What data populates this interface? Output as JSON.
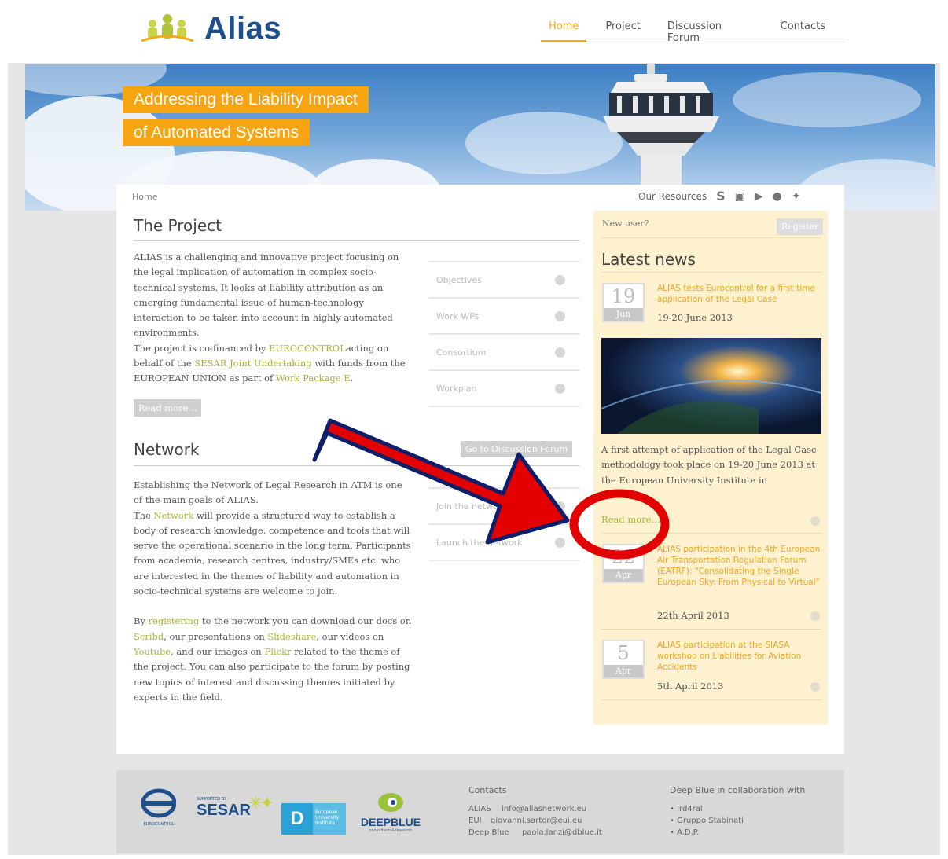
{
  "header": {
    "logo_text": "Alias",
    "nav": [
      "Home",
      "Project",
      "Discussion Forum",
      "Contacts"
    ]
  },
  "hero": {
    "tagline_line1": "Addressing the Liability Impact",
    "tagline_line2": "of Automated Systems"
  },
  "breadcrumb": "Home",
  "resources_label": "Our Resources",
  "social_icons": [
    "scribd-icon",
    "slideshare-icon",
    "youtube-icon",
    "flickr-icon",
    "twitter-icon"
  ],
  "project": {
    "title": "The Project",
    "p1": "ALIAS is a challenging and innovative project focusing on the legal implication of automation in complex socio-technical systems. It looks at liability attribution as an emerging fundamental issue of human-technology interaction to be taken into account in highly automated environments.",
    "p2_a": "The project is co-financed by ",
    "p2_link1": "EUROCONTROL",
    "p2_b": "acting on behalf of the ",
    "p2_link2": "SESAR Joint Undertaking",
    "p2_c": " with funds from the EUROPEAN UNION as part of ",
    "p2_link3": "Work Package E",
    "p2_d": ".",
    "read_more": "Read more..."
  },
  "project_menu": [
    "Objectives",
    "Work WPs",
    "Consortium",
    "Workplan"
  ],
  "network": {
    "title": "Network",
    "forum_button": "Go to Discussion Forum",
    "p1": "Establishing the Network of Legal Research in ATM is one of the main goals of ALIAS.",
    "p2_a": "The ",
    "p2_link": "Network",
    "p2_b": " will provide a structured way to establish a body of research knowledge, competence and tools that will serve the operational scenario in the long term. Participants from academia, research centres, industry/SMEs etc. who are interested in the themes of liability and automation in socio-technical systems are welcome to join.",
    "p3_a": "By ",
    "p3_l1": "registering",
    "p3_b": " to the network you can download our docs on ",
    "p3_l2": "Scribd",
    "p3_c": ", our presentations on ",
    "p3_l3": "Slideshare",
    "p3_d": ", our videos on ",
    "p3_l4": "Youtube",
    "p3_e": ", and our images on ",
    "p3_l5": "Flickr",
    "p3_f": " related to the theme of the project. You can also participate to the forum by posting new topics of interest and discussing themes initiated by experts in the field."
  },
  "network_menu": [
    "Join the network",
    "Launch the network"
  ],
  "sidebar": {
    "new_user": "New user?",
    "register": "Register",
    "latest_news": "Latest news",
    "news": [
      {
        "day": "19",
        "month": "Jun",
        "title": "ALIAS tests Eurocontrol for a first time application of the Legal Case",
        "date": "19-20 June 2013"
      },
      {
        "day": "22",
        "month": "Apr",
        "title": "ALIAS participation in the 4th European Air Transportation Regulation Forum (EATRF): \"Consolidating the Single European Sky: From Physical to Virtual\"",
        "date": "22th April 2013"
      },
      {
        "day": "5",
        "month": "Apr",
        "title": "ALIAS participation at the SIASA workshop on Liabilities for Aviation Accidents",
        "date": "5th April 2013"
      }
    ],
    "feature_text": "A first attempt of application of the Legal Case methodology took place on 19-20 June 2013 at the European University Institute in",
    "read_more": "Read more..."
  },
  "footer": {
    "logos": [
      "EUROCONTROL",
      "SESAR",
      "European University Institute",
      "DEEPBLUE"
    ],
    "sesar_small": "SUPPORTED BY",
    "deepblue_sub": "consultants&research",
    "contacts_title": "Contacts",
    "contacts": [
      {
        "label": "ALIAS",
        "email": "info@aliasnetwork.eu"
      },
      {
        "label": "EUI",
        "email": "giovanni.sartor@eui.eu"
      },
      {
        "label": "Deep Blue",
        "email": "paola.lanzi@dblue.it"
      }
    ],
    "collab_title": "Deep Blue in collaboration with",
    "collab": [
      "Ird4ral",
      "Gruppo Stabinati",
      "A.D.P."
    ]
  },
  "annotation": {
    "arrow_color": "#e30000",
    "circle_color": "#e30000"
  }
}
